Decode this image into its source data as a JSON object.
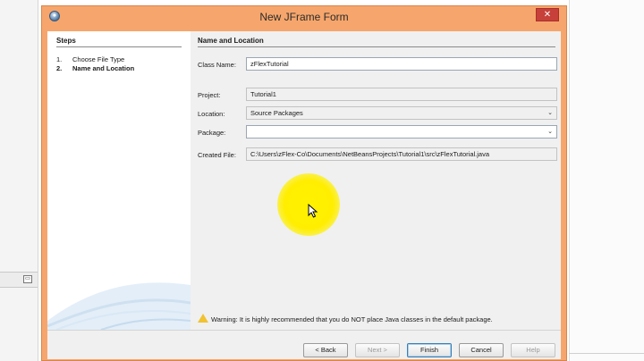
{
  "window": {
    "title": "New JFrame Form",
    "close_glyph": "✕"
  },
  "steps": {
    "header": "Steps",
    "items": [
      {
        "num": "1.",
        "label": "Choose File Type"
      },
      {
        "num": "2.",
        "label": "Name and Location"
      }
    ],
    "current_index": 1
  },
  "form": {
    "section_title": "Name and Location",
    "class_name_label": "Class Name:",
    "class_name_value": "zFlexTutorial",
    "project_label": "Project:",
    "project_value": "Tutorial1",
    "location_label": "Location:",
    "location_value": "Source Packages",
    "package_label": "Package:",
    "package_value": "",
    "created_file_label": "Created File:",
    "created_file_value": "C:\\Users\\zFlex-Co\\Documents\\NetBeansProjects\\Tutorial1\\src\\zFlexTutorial.java"
  },
  "warning": {
    "text": "Warning: It is highly recommended that you do NOT place Java classes in the default package."
  },
  "buttons": {
    "back": "< Back",
    "next": "Next >",
    "finish": "Finish",
    "cancel": "Cancel",
    "help": "Help"
  },
  "colors": {
    "frame_accent": "#f6a66c",
    "close_button": "#c7403a",
    "cursor_highlight": "#fff200"
  },
  "icons": {
    "app": "netbeans-icon",
    "warning": "warning-triangle-icon",
    "dropdown": "chevron-down-icon"
  }
}
